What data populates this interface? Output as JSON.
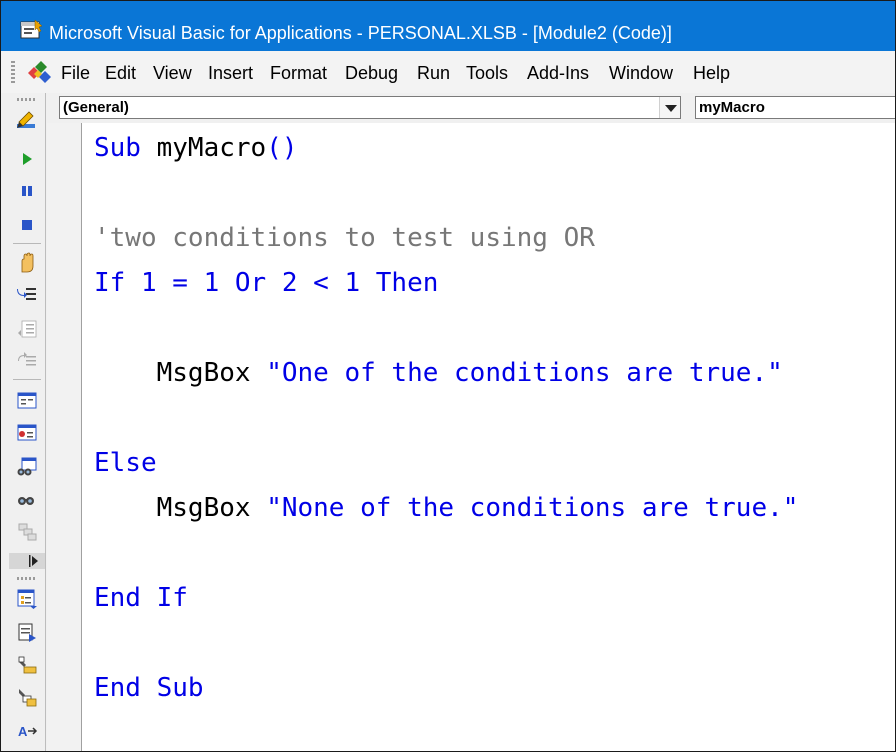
{
  "window": {
    "title": "Microsoft Visual Basic for Applications - PERSONAL.XLSB - [Module2 (Code)]",
    "app_icon": "vba-editor-icon",
    "title_bar_color": "#0a76d6"
  },
  "menu": {
    "app_icon": "vba-project-icon",
    "items": [
      "File",
      "Edit",
      "View",
      "Insert",
      "Format",
      "Debug",
      "Run",
      "Tools",
      "Add-Ins",
      "Window",
      "Help"
    ]
  },
  "toolbar": {
    "buttons": [
      "design-mode-icon",
      "run-icon",
      "break-icon",
      "reset-icon",
      "toggle-breakpoint-icon",
      "step-into-icon",
      "step-over-icon",
      "step-out-icon",
      "locals-window-icon",
      "immediate-window-icon",
      "watch-window-icon",
      "quick-watch-icon",
      "call-stack-icon",
      "project-explorer-icon",
      "properties-window-icon",
      "object-browser-icon",
      "toolbox-icon",
      "sort-icon"
    ]
  },
  "code_window": {
    "object_combo": "(General)",
    "procedure_combo": "myMacro",
    "colors": {
      "keyword": "#0000e6",
      "comment": "#777777",
      "text": "#000000"
    },
    "lines": {
      "sub_kw": "Sub",
      "sub_name": " myMacro",
      "sub_parens": "()",
      "comment": "'two conditions to test using OR",
      "if_kw": "If",
      "if_cond": " 1 = 1 ",
      "or_kw": "Or",
      "if_cond2": " 2 < 1 ",
      "then_kw": "Then",
      "msgbox1_kw": "    MsgBox ",
      "msgbox1_str": "\"One of the conditions are true.\"",
      "else_kw": "Else",
      "msgbox2_kw": "    MsgBox ",
      "msgbox2_str": "\"None of the conditions are true.\"",
      "endif_kw": "End If",
      "endsub_kw": "End Sub"
    }
  }
}
